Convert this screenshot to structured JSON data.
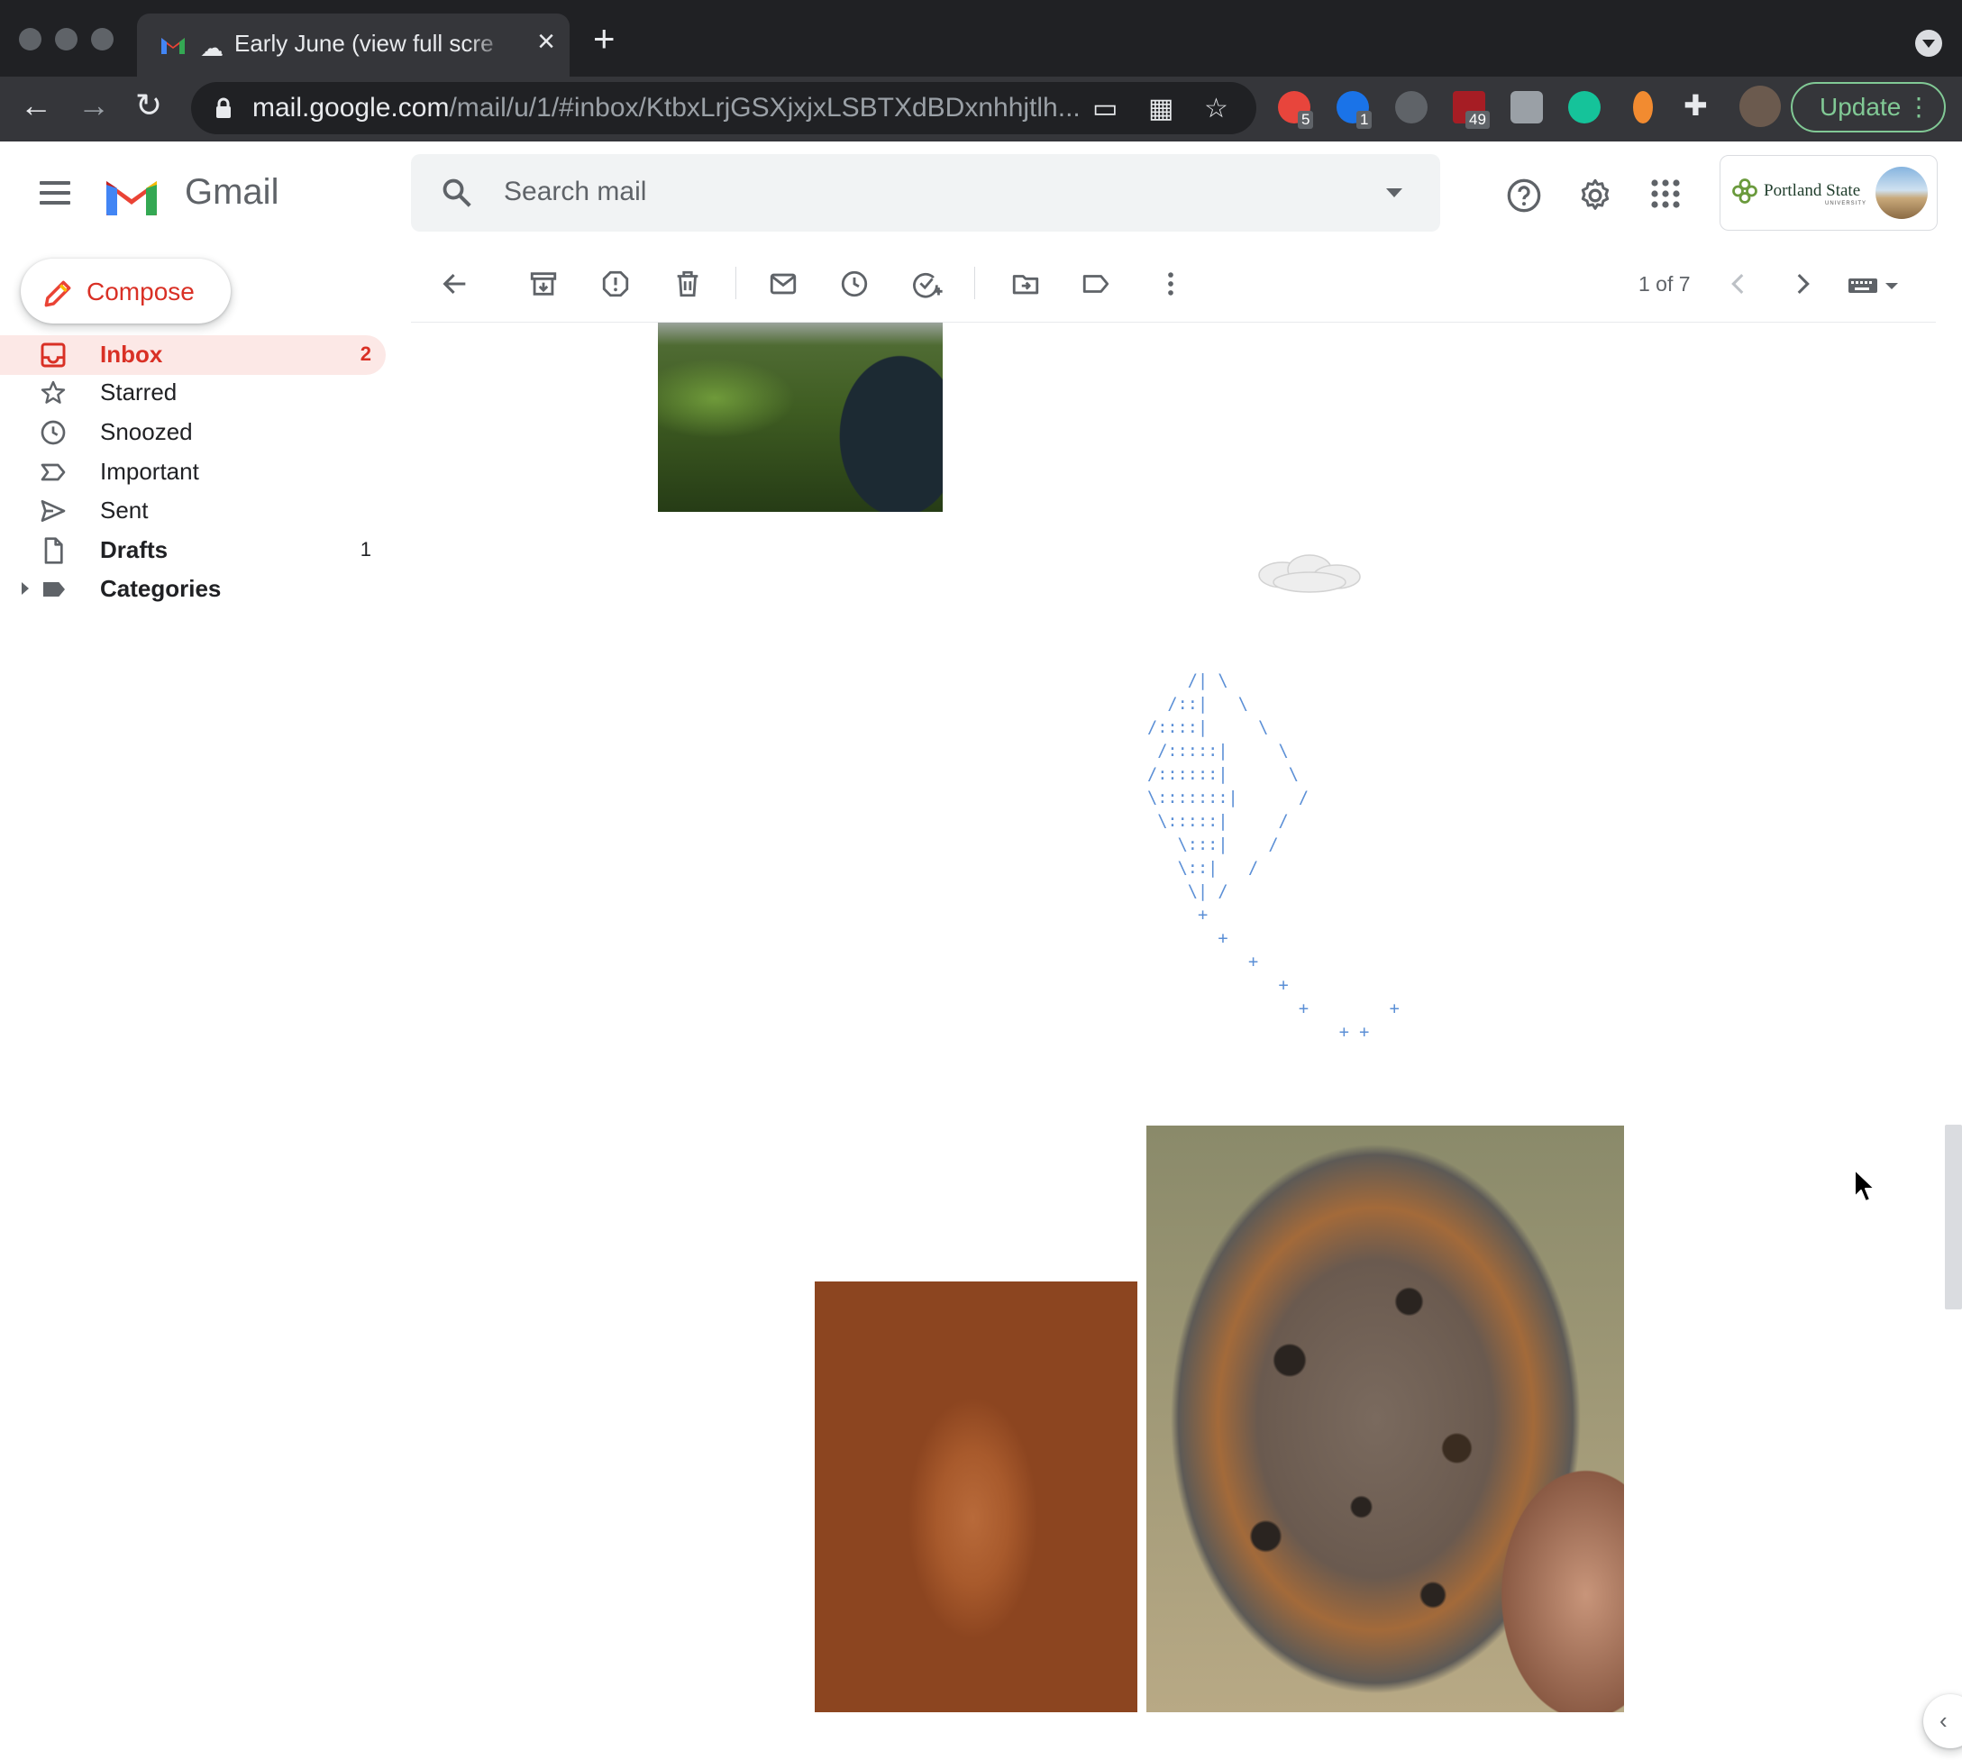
{
  "browser": {
    "tab_title": "Early June (view full scre",
    "url_host": "mail.google.com",
    "url_path": "/mail/u/1/#inbox/KtbxLrjGSXjxjxLSBTXdBDxnhhjtlh...",
    "update_label": "Update",
    "extensions": [
      {
        "name": "ABP",
        "badge": "5",
        "color": "#e8453c"
      },
      {
        "name": "ghostery",
        "badge": "1",
        "color": "#1a73e8"
      },
      {
        "name": "pinterest",
        "badge": "",
        "color": "#5f6368"
      },
      {
        "name": "ublock",
        "badge": "49",
        "color": "#a61d24"
      },
      {
        "name": "grammarly",
        "badge": "",
        "color": "#15c39a"
      }
    ]
  },
  "gmail": {
    "product_name": "Gmail",
    "search_placeholder": "Search mail",
    "org_name": "Portland State",
    "org_sub": "UNIVERSITY",
    "compose_label": "Compose",
    "nav": [
      {
        "label": "Inbox",
        "count": "2",
        "icon": "inbox-icon",
        "active": true
      },
      {
        "label": "Starred",
        "count": "",
        "icon": "star-icon"
      },
      {
        "label": "Snoozed",
        "count": "",
        "icon": "clock-icon"
      },
      {
        "label": "Important",
        "count": "",
        "icon": "label-important-icon"
      },
      {
        "label": "Sent",
        "count": "",
        "icon": "send-icon"
      },
      {
        "label": "Drafts",
        "count": "1",
        "icon": "draft-icon",
        "bold": true
      },
      {
        "label": "Categories",
        "count": "",
        "icon": "label-icon",
        "bold": true
      }
    ],
    "pager_text": "1 of 7"
  },
  "message": {
    "ascii_art": "    /| \\\n  /::|   \\\n/::::|     \\\n /:::::|     \\\n/::::::|      \\\n\\:::::::|      /\n \\:::::|     /\n   \\:::|    /\n   \\::|   /\n    \\| /\n     +\n       +\n          +\n             +\n               +        +\n                   + +",
    "ascii_color": "#5b8fd6"
  },
  "colors": {
    "accent_red": "#d93025",
    "active_bg": "#fce8e6",
    "chrome_dark": "#202124",
    "update_green": "#81c995"
  }
}
